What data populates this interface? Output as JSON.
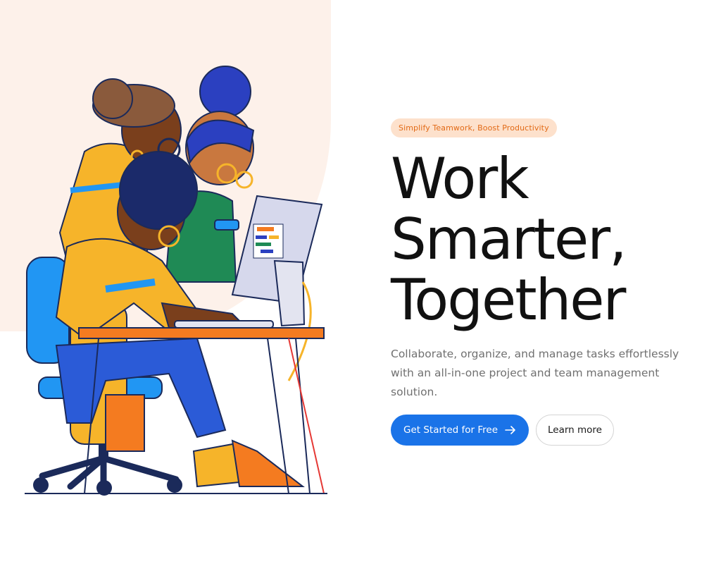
{
  "hero": {
    "badge": "Simplify Teamwork, Boost Productivity",
    "headline_lines": [
      "Work",
      "Smarter,",
      "Together"
    ],
    "subtitle": "Collaborate, organize, and manage tasks effortlessly with an all-in-one project and team management solution.",
    "primary_cta": "Get Started for Free",
    "primary_cta_icon": "arrow-right-icon",
    "secondary_cta": "Learn more"
  },
  "colors": {
    "accent": "#1a73e8",
    "badge_bg": "#fde1cc",
    "badge_text": "#e26a16",
    "illustration_bg": "#fdf1ea"
  }
}
